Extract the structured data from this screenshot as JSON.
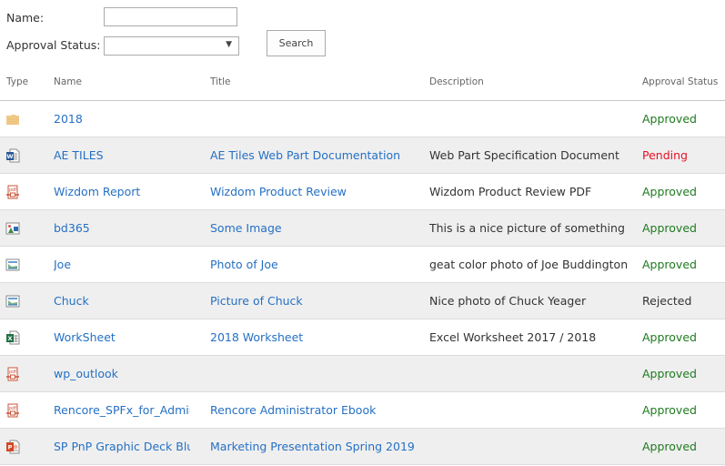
{
  "form": {
    "name_label": "Name:",
    "name_value": "",
    "status_label": "Approval Status:",
    "status_selected": "",
    "search_label": "Search",
    "dropdown_arrow": "▼"
  },
  "table": {
    "headers": {
      "type": "Type",
      "name": "Name",
      "title": "Title",
      "description": "Description",
      "status": "Approval Status"
    },
    "rows": [
      {
        "icon": "folder-icon",
        "name": "2018",
        "title": "",
        "description": "",
        "status": "Approved",
        "status_kind": "approved"
      },
      {
        "icon": "word-doc-icon",
        "name": "AE TILES",
        "title": "AE Tiles Web Part Documentation",
        "description": "Web Part Specification Document",
        "status": "Pending",
        "status_kind": "pending"
      },
      {
        "icon": "pdf-icon",
        "name": "Wizdom  Report",
        "title": "Wizdom Product Review",
        "description": "Wizdom Product Review PDF",
        "status": "Approved",
        "status_kind": "approved"
      },
      {
        "icon": "image-icon",
        "name": "bd365",
        "title": "Some Image",
        "description": "This is a nice picture of something",
        "status": "Approved",
        "status_kind": "approved"
      },
      {
        "icon": "photo-icon",
        "name": "Joe",
        "title": "Photo of Joe",
        "description": "geat color photo of Joe Buddington",
        "status": "Approved",
        "status_kind": "approved"
      },
      {
        "icon": "photo-icon",
        "name": "Chuck",
        "title": "Picture of Chuck",
        "description": "Nice photo of Chuck Yeager",
        "status": "Rejected",
        "status_kind": "rejected"
      },
      {
        "icon": "excel-icon",
        "name": "WorkSheet",
        "title": "2018 Worksheet",
        "description": "Excel Worksheet 2017 / 2018",
        "status": "Approved",
        "status_kind": "approved"
      },
      {
        "icon": "pdf-icon",
        "name": "wp_outlook",
        "title": "",
        "description": "",
        "status": "Approved",
        "status_kind": "approved"
      },
      {
        "icon": "pdf-icon",
        "name": "Rencore_SPFx_for_Admins",
        "title": "Rencore Administrator Ebook",
        "description": "",
        "status": "Approved",
        "status_kind": "approved"
      },
      {
        "icon": "powerpoint-icon",
        "name": "SP PnP Graphic Deck Blue",
        "title": "Marketing Presentation Spring 2019",
        "description": "",
        "status": "Approved",
        "status_kind": "approved"
      }
    ]
  },
  "colors": {
    "link": "#2570c4",
    "approved": "#1f7a1f",
    "pending": "#e81123",
    "rejected": "#333333",
    "alt_row": "#efefef"
  }
}
